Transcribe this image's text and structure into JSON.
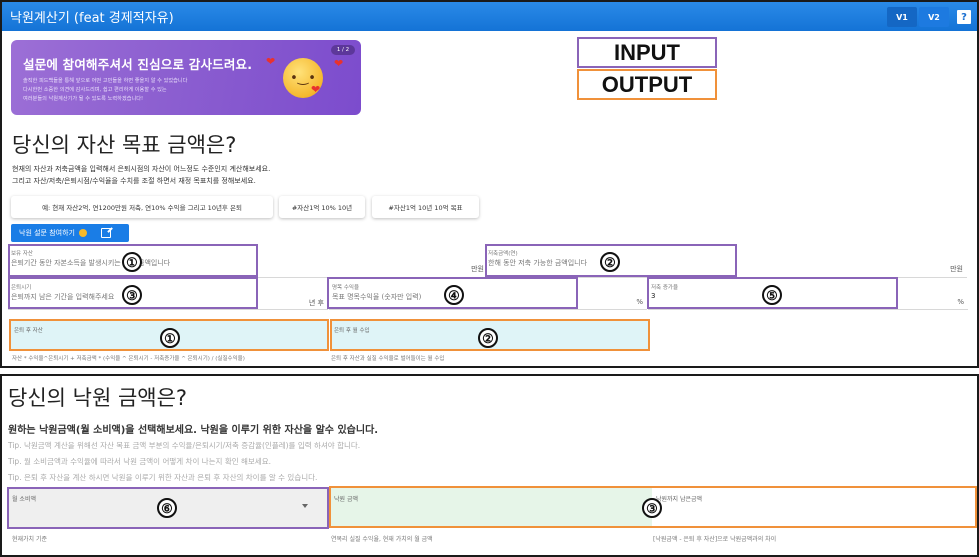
{
  "app": {
    "title": "낙원계산기 (feat 경제적자유)",
    "versions": [
      "V1",
      "V2"
    ],
    "active_version": "V2",
    "help_label": "?"
  },
  "banner": {
    "title": "설문에 참여해주셔서 진심으로 감사드려요.",
    "lines": [
      "솔직한 피드백들을 통해 앞으로 어떤 고민들을 하면 좋을지 알 수 있었습니다",
      "다시한번 소중한 의견에 감사드리며, 쉽고 편리하게 이용할 수 있는",
      "여러분들의 낙원계산기가 될 수 있도록 노력하겠습니다!"
    ],
    "counter": "1 / 2",
    "emoji": "kissing-face-with-hearts"
  },
  "legend": {
    "input": "INPUT",
    "output": "OUTPUT",
    "input_color": "#8a64b8",
    "output_color": "#f0913a"
  },
  "asset_goal": {
    "heading": "당신의 자산 목표 금액은?",
    "description": [
      "현재의 자산과 저축금액을 입력해서 은퇴시점의 자산이 어느정도 수준인지 계산해보세요.",
      "그리고 자산/저축/은퇴시점/수익율을 수치를 조절 하면서 재정 목표치를 정해보세요."
    ],
    "chips": [
      "예: 현재 자산2억, 연1200만원 저축, 연10% 수익을 그리고 10년후 은퇴",
      "#자산1억 10% 10년",
      "#자산1억 10년 10억 목표"
    ],
    "survey_button": "낙원 설문 참여하기",
    "inputs": {
      "assets": {
        "label": "보유 자산",
        "placeholder": "은퇴기간 동안 자본소득을 발생시키는 자산 금액입니다",
        "unit": "만원",
        "badge": "①"
      },
      "savings": {
        "label": "저축금액(연)",
        "placeholder": "한해 동안 저축 가능한 금액입니다",
        "unit": "만원",
        "badge": "②"
      },
      "retire": {
        "label": "은퇴시기",
        "placeholder": "은퇴까지 남은 기간을 입력해주세요",
        "unit": "년 후",
        "badge": "③"
      },
      "return_rate": {
        "label": "명목 수익율",
        "placeholder": "목표 명목수익율 (숫자만 입력)",
        "unit": "%",
        "badge": "④"
      },
      "savings_growth": {
        "label": "저축 증가율",
        "value": "3",
        "unit": "%",
        "badge": "⑤"
      }
    },
    "outputs": {
      "asset_after_retire": {
        "label": "은퇴 후 자산",
        "helper": "자산 * 수익율^은퇴시기 + 저축금액 * (수익율 ^ 은퇴시기 - 저축증가율 ^ 은퇴시기) / (실질수익율)",
        "badge": "①"
      },
      "monthly_income": {
        "label": "은퇴 후 월 수입",
        "helper": "은퇴 후 자산과 실질 수익율로 벌어들이는 월 수입",
        "badge": "②"
      }
    }
  },
  "paradise": {
    "heading": "당신의 낙원 금액은?",
    "subheading": "원하는 낙원금액(월 소비액)을 선택해보세요. 낙원을 이루기 위한 자산을 알수 있습니다.",
    "tips": [
      "Tip. 낙원금액 계산을 위해선 자산 목표 금액 부분의 수익율/은퇴시기/저축 증감율(인플레)를 입력 하셔야 합니다.",
      "Tip. 월 소비금액과 수익율에 따라서 낙원 금액이 어떻게 차이 나는지 확인 해보세요.",
      "Tip. 은퇴 후 자산을 계산 하시면 낙원을 이루기 위한 자산과 은퇴 후 자산의 차이를 알 수 있습니다."
    ],
    "monthly_spend": {
      "label": "월 소비액",
      "selected": "",
      "helper": "현재가치 기준",
      "badge": "⑥"
    },
    "paradise_amount": {
      "label": "낙원 금액",
      "helper": "연복리 실질 수익율, 현재 가치의 월 금액"
    },
    "remaining": {
      "label": "낙원까지 남은금액",
      "helper": "[낙원금액 - 은퇴 후 자산]으로 낙원금액과의 차이",
      "badge": "③"
    }
  }
}
